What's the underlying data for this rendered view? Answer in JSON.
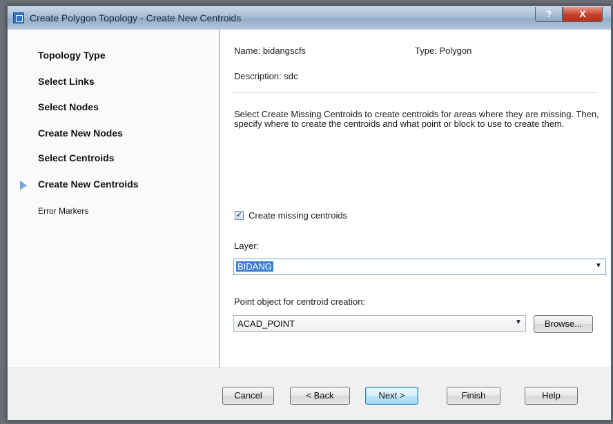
{
  "window": {
    "title": "Create Polygon Topology - Create New Centroids",
    "help_label": "?",
    "close_label": "X"
  },
  "steps": [
    {
      "label": "Topology Type",
      "state": "done"
    },
    {
      "label": "Select Links",
      "state": "done"
    },
    {
      "label": "Select Nodes",
      "state": "done"
    },
    {
      "label": "Create New Nodes",
      "state": "done"
    },
    {
      "label": "Select Centroids",
      "state": "done"
    },
    {
      "label": "Create New Centroids",
      "state": "current"
    },
    {
      "label": "Error Markers",
      "state": "pending"
    }
  ],
  "info": {
    "name": "Name: bidangscfs",
    "type": "Type: Polygon",
    "description": "Description: sdc"
  },
  "instructions": "Select Create Missing Centroids to create centroids for areas where they are missing. Then, specify where to create the centroids and what point or block to use to create them.",
  "create_missing": {
    "label": "Create missing centroids",
    "checked": true,
    "check_glyph": "✓"
  },
  "layer": {
    "label": "Layer:",
    "value": "BIDANG"
  },
  "point_object": {
    "label": "Point object for centroid creation:",
    "value": "ACAD_POINT",
    "browse_label": "Browse..."
  },
  "footer": {
    "cancel": "Cancel",
    "back": "< Back",
    "next": "Next >",
    "finish": "Finish",
    "help": "Help"
  }
}
